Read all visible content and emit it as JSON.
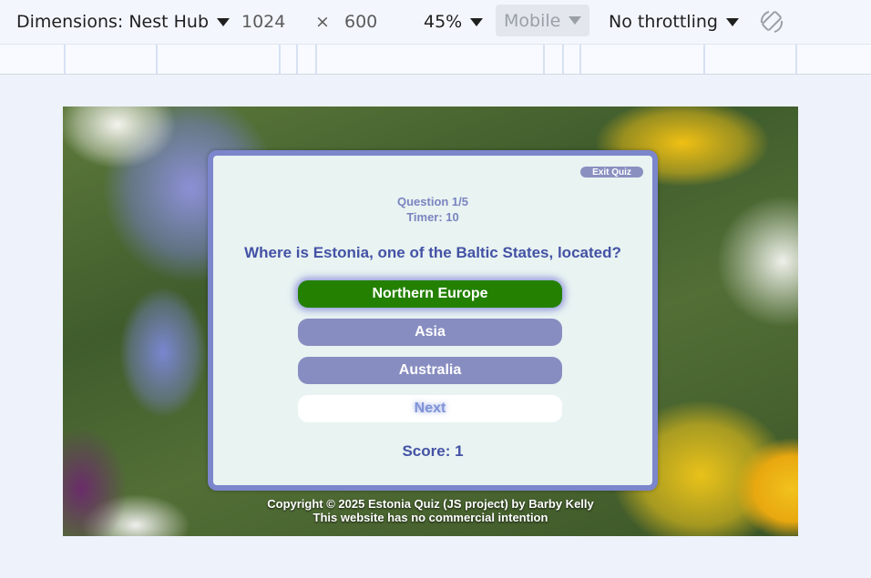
{
  "devtools": {
    "dimensions_label": "Dimensions: Nest Hub",
    "width": "1024",
    "times": "×",
    "height": "600",
    "zoom": "45%",
    "device_mode": "Mobile",
    "throttling": "No throttling",
    "rotate_icon": "rotate-icon"
  },
  "quiz": {
    "exit_label": "Exit Quiz",
    "question_counter": "Question 1/5",
    "timer": "Timer: 10",
    "question": "Where is Estonia, one of the Baltic States, located?",
    "answers": [
      {
        "label": "Northern Europe",
        "state": "correct"
      },
      {
        "label": "Asia",
        "state": "default"
      },
      {
        "label": "Australia",
        "state": "default"
      }
    ],
    "next_label": "Next",
    "score": "Score: 1"
  },
  "footer": {
    "line1": "Copyright © 2025 Estonia Quiz (JS project) by Barby Kelly",
    "line2": "This website has no commercial intention"
  },
  "colors": {
    "card_border": "#7b86cc",
    "correct": "#238000",
    "answer": "#878dc0",
    "question_text": "#4452a5"
  }
}
